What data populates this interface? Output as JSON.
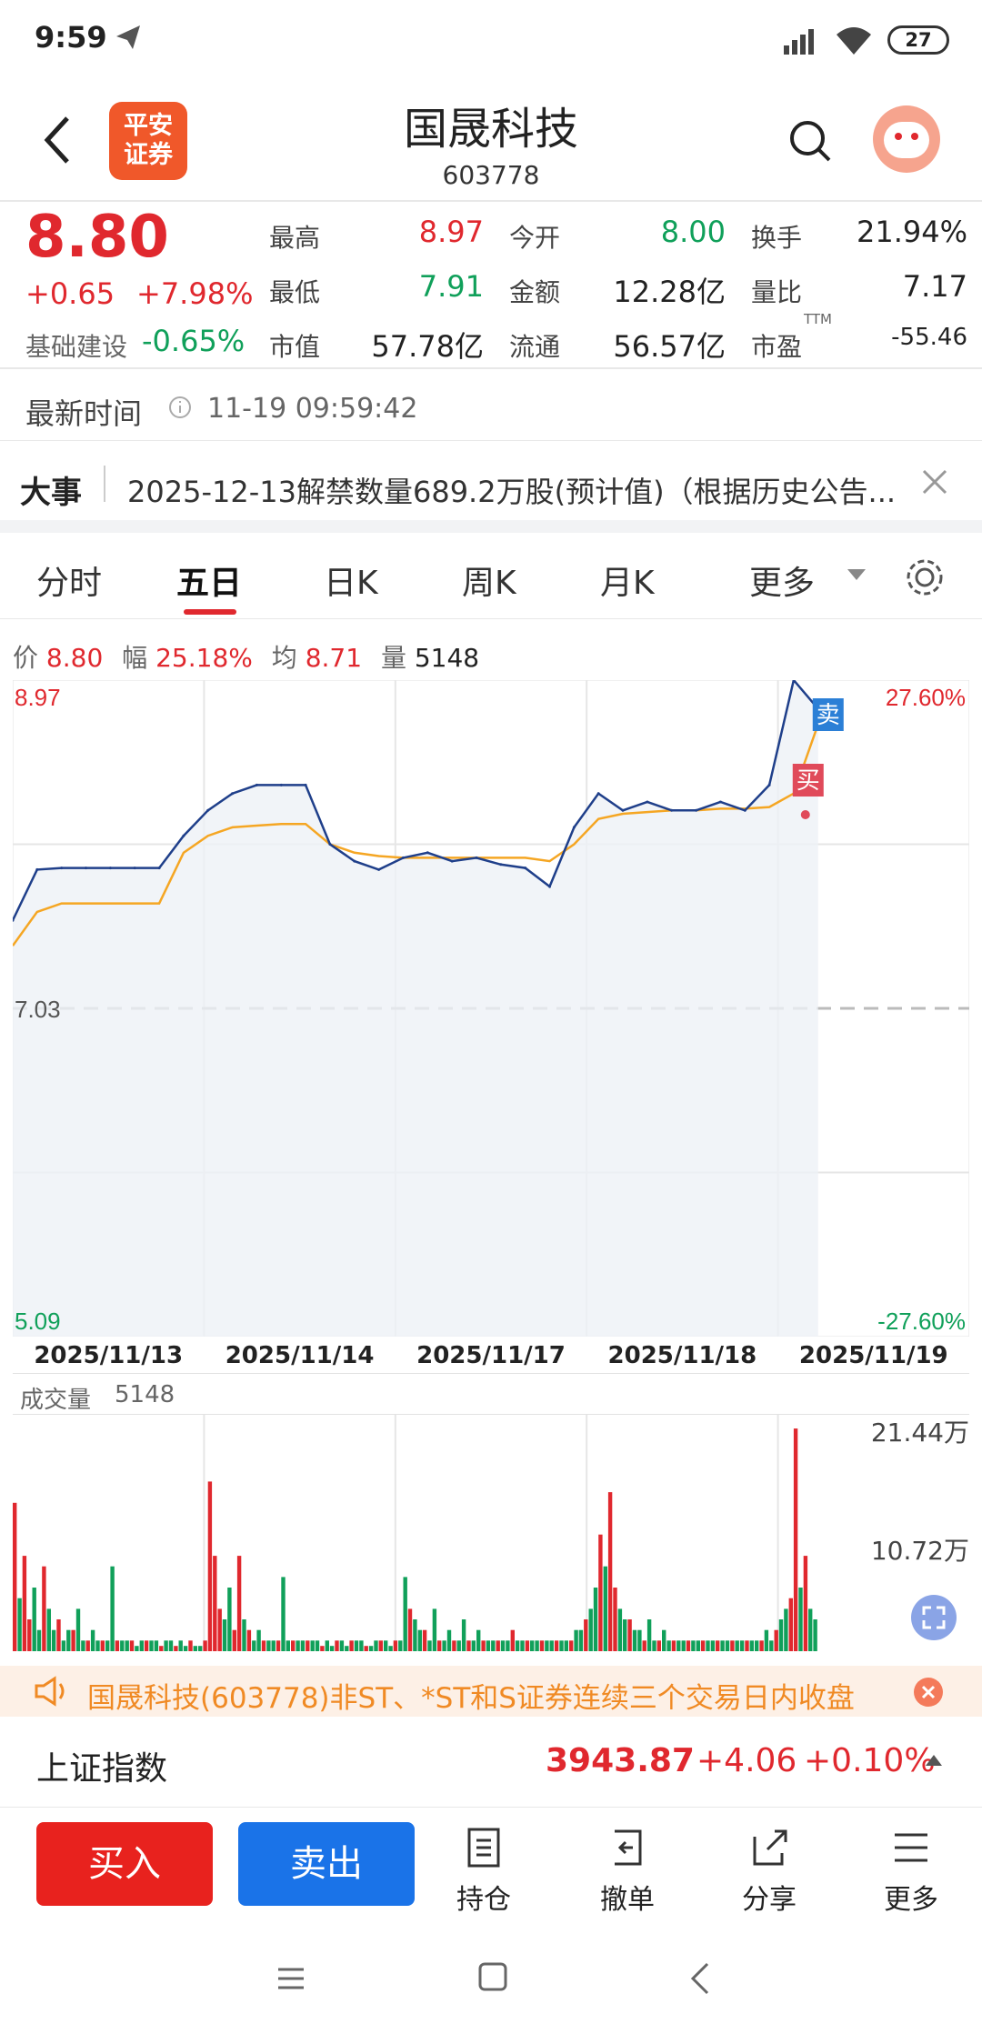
{
  "status_bar": {
    "time": "9:59",
    "battery": "27"
  },
  "header": {
    "title": "国晟科技",
    "code": "603778",
    "logo_line1": "平安",
    "logo_line2": "证券"
  },
  "quote": {
    "price": "8.80",
    "change": "+0.65",
    "change_pct": "+7.98%",
    "sector": "基础建设",
    "sector_pct": "-0.65%",
    "grid": [
      {
        "label": "最高",
        "value": "8.97"
      },
      {
        "label": "今开",
        "value": "8.00"
      },
      {
        "label": "换手",
        "value": "21.94%"
      },
      {
        "label": "最低",
        "value": "7.91"
      },
      {
        "label": "金额",
        "value": "12.28亿"
      },
      {
        "label": "量比",
        "value": "7.17"
      },
      {
        "label": "市值",
        "value": "57.78亿"
      },
      {
        "label": "流通",
        "value": "56.57亿"
      },
      {
        "label": "市盈",
        "value": "-55.46",
        "sup": "TTM"
      }
    ]
  },
  "update": {
    "label": "最新时间",
    "time": "11-19 09:59:42"
  },
  "news": {
    "tag": "大事",
    "text": "2025-12-13解禁数量689.2万股(预计值)（根据历史公告..."
  },
  "tabs": [
    "分时",
    "五日",
    "日K",
    "周K",
    "月K",
    "更多"
  ],
  "chart_info": {
    "price_label": "价",
    "price": "8.80",
    "amp_label": "幅",
    "amp": "25.18%",
    "avg_label": "均",
    "avg": "8.71",
    "vol_label": "量",
    "vol": "5148"
  },
  "chart_data": {
    "type": "line",
    "x": [
      "2025/11/13",
      "2025/11/14",
      "2025/11/17",
      "2025/11/18",
      "2025/11/19"
    ],
    "y_left_ticks": [
      "8.97",
      "7.03",
      "5.09"
    ],
    "y_right_ticks": [
      "27.60%",
      "-27.60%"
    ],
    "ylim": [
      5.09,
      8.97
    ],
    "baseline": 7.03,
    "series": [
      {
        "values": [
          7.55,
          7.85,
          7.86,
          7.86,
          7.86,
          7.86,
          7.86,
          8.05,
          8.2,
          8.3,
          8.35,
          8.35,
          8.35,
          8.0,
          7.9,
          7.85,
          7.92,
          7.95,
          7.9,
          7.92,
          7.88,
          7.86,
          7.75,
          8.1,
          8.3,
          8.2,
          8.25,
          8.2,
          8.2,
          8.25,
          8.2,
          8.35,
          8.97,
          8.8
        ]
      },
      {
        "values": [
          7.4,
          7.6,
          7.65,
          7.65,
          7.65,
          7.65,
          7.65,
          7.95,
          8.05,
          8.1,
          8.11,
          8.12,
          8.12,
          8.0,
          7.95,
          7.93,
          7.92,
          7.92,
          7.92,
          7.92,
          7.92,
          7.92,
          7.9,
          8.0,
          8.15,
          8.18,
          8.19,
          8.2,
          8.2,
          8.21,
          8.21,
          8.22,
          8.3,
          8.71
        ]
      }
    ],
    "markers": [
      "卖",
      "买"
    ]
  },
  "volume": {
    "label": "成交量",
    "value": "5148",
    "ticks": [
      "21.44万",
      "10.72万"
    ]
  },
  "volume_data": {
    "type": "bar",
    "ylim": [
      0,
      21.44
    ],
    "values": [
      14,
      5,
      9,
      3,
      6,
      2,
      8,
      4,
      2,
      3,
      1,
      2,
      2,
      4,
      1,
      1,
      2,
      1,
      1,
      1,
      8,
      1,
      1,
      1,
      1,
      0.5,
      1,
      1,
      1,
      1,
      0.5,
      1,
      1,
      0.5,
      1,
      0.5,
      1,
      0.5,
      0.5,
      1,
      16,
      9,
      4,
      3,
      6,
      2,
      9,
      3,
      2,
      1,
      2,
      1,
      1,
      1,
      1,
      7,
      1,
      1,
      1,
      1,
      1,
      1,
      1,
      0.5,
      1,
      0.5,
      1,
      1,
      0.5,
      1,
      1,
      1,
      0.5,
      0.5,
      1,
      1,
      1,
      0.5,
      1,
      1,
      7,
      4,
      3,
      2,
      2,
      1,
      4,
      1,
      1,
      2,
      1,
      1,
      3,
      1,
      1,
      2,
      1,
      1,
      1,
      1,
      1,
      1,
      2,
      1,
      1,
      1,
      1,
      1,
      1,
      1,
      1,
      1,
      1,
      1,
      1,
      2,
      2,
      3,
      4,
      6,
      11,
      8,
      15,
      6,
      4,
      3,
      3,
      2,
      2,
      1,
      3,
      1,
      1,
      2,
      1,
      1,
      1,
      1,
      1,
      1,
      1,
      1,
      1,
      1,
      1,
      1,
      1,
      1,
      1,
      1,
      1,
      1,
      1,
      1,
      2,
      1,
      2,
      3,
      4,
      5,
      21,
      6,
      9,
      4,
      3
    ],
    "colors_up": "#e0282e",
    "colors_down": "#10a05a"
  },
  "notice": {
    "text": "国晟科技(603778)非ST、*ST和S证券连续三个交易日内收盘"
  },
  "index_bar": {
    "name": "上证指数",
    "value": "3943.87",
    "change": "+4.06",
    "pct": "+0.10%"
  },
  "bottom_bar": {
    "buy": "买入",
    "sell": "卖出",
    "items": [
      "持仓",
      "撤单",
      "分享",
      "更多"
    ]
  },
  "colors": {
    "up": "#e0282e",
    "down": "#10a05a",
    "accent": "#e0282e",
    "blue": "#1a73e8"
  }
}
